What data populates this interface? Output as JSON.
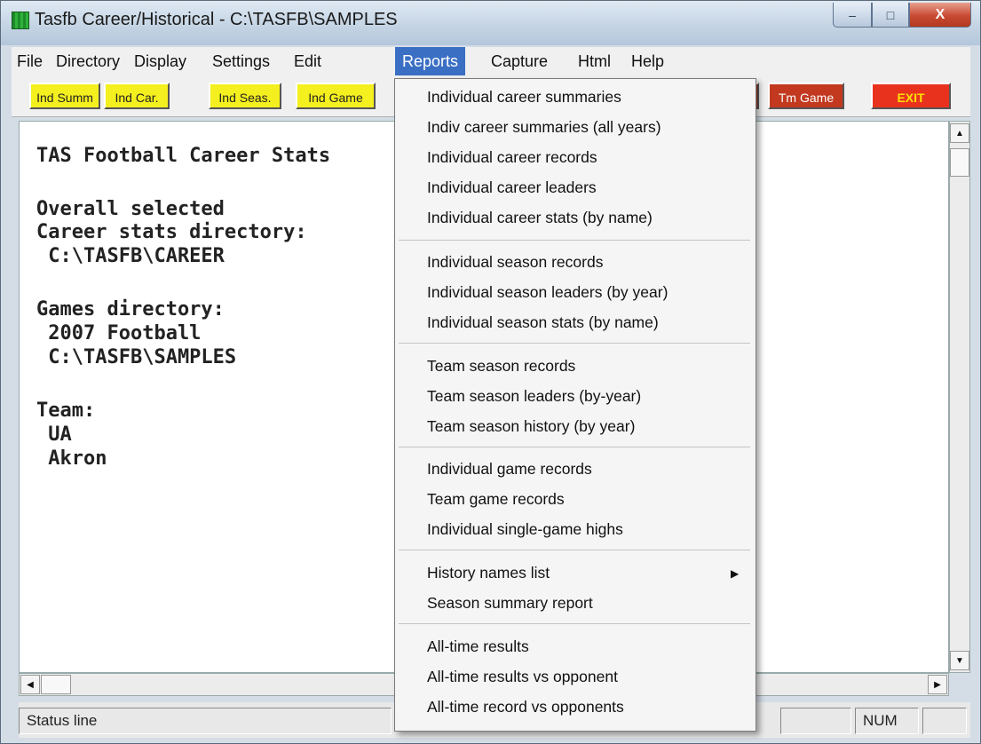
{
  "window": {
    "title": "Tasfb Career/Historical - C:\\TASFB\\SAMPLES",
    "minimize_symbol": "–",
    "maximize_symbol": "□",
    "close_symbol": "X"
  },
  "menubar": {
    "items": [
      "File",
      "Directory",
      "Display",
      "Settings",
      "Edit",
      "Reports",
      "Capture",
      "Html",
      "Help"
    ],
    "active": "Reports"
  },
  "toolbar": {
    "buttons": [
      "Ind Summ",
      "Ind Car.",
      "Ind Seas.",
      "Ind Game",
      "Tm Game",
      "EXIT"
    ]
  },
  "report": {
    "lines": [
      "TAS Football Career Stats",
      "Overall selected",
      "Career stats directory:",
      " C:\\TASFB\\CAREER",
      "Games directory:",
      " 2007 Football",
      " C:\\TASFB\\SAMPLES",
      "Team:",
      " UA",
      " Akron"
    ]
  },
  "scrollbars": {
    "up": "▲",
    "down": "▼",
    "left": "◀",
    "right": "▶"
  },
  "status": {
    "text": "Status line",
    "num": "NUM"
  },
  "reports_menu": {
    "items": [
      "Individual career summaries",
      "Indiv career summaries (all years)",
      "Individual career records",
      "Individual career leaders",
      "Individual career stats (by name)",
      "Individual season records",
      "Individual season leaders (by year)",
      "Individual season stats (by name)",
      "Team season records",
      "Team season leaders (by-year)",
      "Team season history (by year)",
      "Individual game records",
      "Team game records",
      "Individual single-game highs",
      "History names list",
      "Season summary report",
      "All-time results",
      "All-time results vs opponent",
      "All-time record vs opponents"
    ],
    "submenu_arrow": "▶"
  },
  "colors": {
    "toolbar_yellow": "#f4ef1e",
    "toolbar_red": "#c2391f",
    "exit_red": "#e8321e",
    "menu_highlight": "#3a6fc4"
  }
}
